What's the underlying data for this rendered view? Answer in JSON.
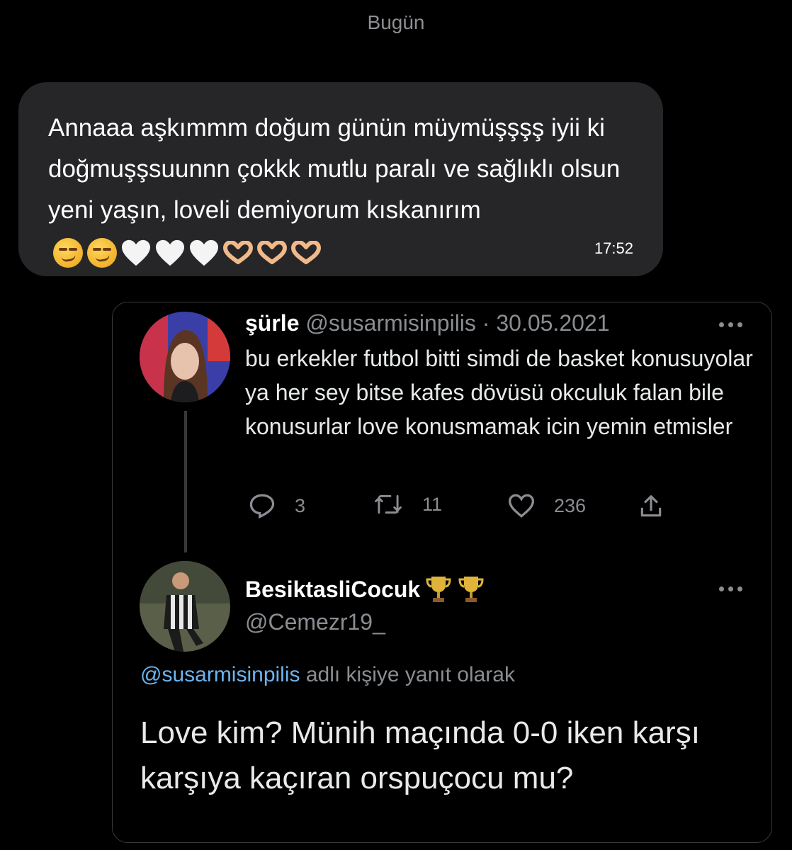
{
  "chat": {
    "day_label": "Bugün",
    "message": {
      "text": "Annaaa aşkımmm doğum günün müymüşşşş iyii ki doğmuşşsuunnn çokkk mutlu paralı ve sağlıklı olsun yeni yaşın, loveli demiyorum kıskanırım",
      "emojis": [
        "smirk-icon",
        "smirk-icon",
        "white-heart-icon",
        "white-heart-icon",
        "white-heart-icon",
        "heart-hands-icon",
        "heart-hands-icon",
        "heart-hands-icon"
      ],
      "time": "17:52"
    }
  },
  "quoted_thread": {
    "tweet1": {
      "display_name": "şürle",
      "handle": "@susarmisinpilis",
      "separator": "·",
      "date": "30.05.2021",
      "text": "bu erkekler futbol bitti simdi de basket konusuyolar ya her sey bitse kafes dövüsü okculuk falan bile konusurlar love konusmamak icin yemin etmisler",
      "replies": "3",
      "retweets": "11",
      "likes": "236"
    },
    "tweet2": {
      "display_name": "BesiktasliCocuk",
      "badges": [
        "trophy-icon",
        "trophy-icon"
      ],
      "handle": "@Cemezr19_",
      "reply_mention": "@susarmisinpilis",
      "reply_suffix": "adlı kişiye yanıt olarak",
      "text": "Love kim? Münih maçında 0-0 iken karşı karşıya kaçıran orspuçocu mu?"
    }
  },
  "colors": {
    "background": "#000000",
    "bubble": "#262628",
    "muted": "#8a8d91",
    "mention": "#6cb4ef",
    "border": "#3a3a3c"
  }
}
